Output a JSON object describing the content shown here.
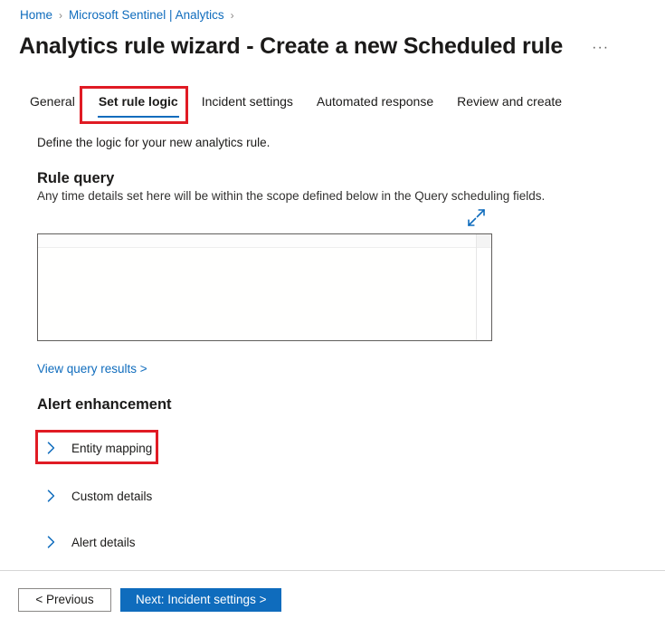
{
  "breadcrumb": {
    "items": [
      {
        "label": "Home"
      },
      {
        "label": "Microsoft Sentinel | Analytics"
      }
    ],
    "separator": "›"
  },
  "header": {
    "title": "Analytics rule wizard - Create a new Scheduled rule",
    "more_menu": "···"
  },
  "tabs": [
    {
      "label": "General",
      "selected": false
    },
    {
      "label": "Set rule logic",
      "selected": true
    },
    {
      "label": "Incident settings",
      "selected": false
    },
    {
      "label": "Automated response",
      "selected": false
    },
    {
      "label": "Review and create",
      "selected": false
    }
  ],
  "main": {
    "intro": "Define the logic for your new analytics rule.",
    "rule_query": {
      "heading": "Rule query",
      "description": "Any time details set here will be within the scope defined below in the Query scheduling fields.",
      "expand_icon": "expand-diagonal-icon",
      "editor_value": "",
      "results_link": "View query results >"
    },
    "alert_enhancement": {
      "heading": "Alert enhancement",
      "sections": [
        {
          "label": "Entity mapping",
          "icon": "chevron-right-icon",
          "expanded": false,
          "highlighted": true
        },
        {
          "label": "Custom details",
          "icon": "chevron-right-icon",
          "expanded": false,
          "highlighted": false
        },
        {
          "label": "Alert details",
          "icon": "chevron-right-icon",
          "expanded": false,
          "highlighted": false
        }
      ]
    }
  },
  "footer": {
    "previous_label": "< Previous",
    "next_label": "Next: Incident settings >"
  },
  "colors": {
    "accent_blue": "#0f6cbd",
    "highlight_red": "#e01b24",
    "text_primary": "#1b1a19"
  }
}
